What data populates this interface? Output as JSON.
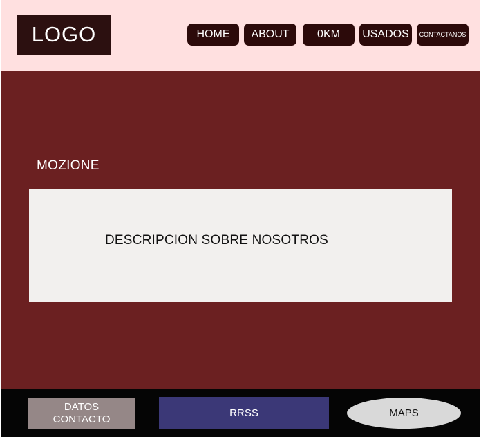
{
  "header": {
    "logo_text": "LOGO",
    "nav": {
      "home": "HOME",
      "about": "ABOUT",
      "zero_km": "0KM",
      "usados": "USADOS",
      "contactanos": "CONTACTANOS"
    }
  },
  "main": {
    "brand_name": "MOZIONE",
    "description": "DESCRIPCION SOBRE NOSOTROS"
  },
  "footer": {
    "contact_line1": "DATOS",
    "contact_line2": "CONTACTO",
    "rrss": "RRSS",
    "maps": "MAPS"
  },
  "colors": {
    "header_bg": "#ffe0e0",
    "nav_bg": "#2c0a0a",
    "main_bg": "#6b2021",
    "box_bg": "#f2f0ee",
    "footer_bg": "#050505",
    "contact_bg": "#958787",
    "rrss_bg": "#3b3877",
    "maps_bg": "#d9d9d9"
  }
}
